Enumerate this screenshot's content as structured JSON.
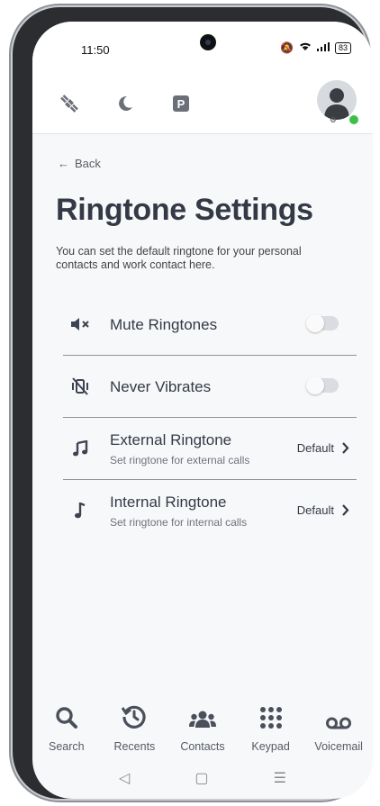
{
  "status_bar": {
    "time": "11:50",
    "battery": "83"
  },
  "appbar": {
    "icons": [
      "satellite-icon",
      "moon-icon",
      "parking-icon"
    ]
  },
  "back_label": "Back",
  "page": {
    "title": "Ringtone Settings",
    "description": "You can set the default ringtone for your personal contacts and work contact here."
  },
  "settings": [
    {
      "label": "Mute Ringtones",
      "icon": "mute-speaker-icon",
      "control": "toggle",
      "on": false
    },
    {
      "label": "Never Vibrates",
      "icon": "vibrate-off-icon",
      "control": "toggle",
      "on": false
    },
    {
      "label": "External Ringtone",
      "subtitle": "Set ringtone for external calls",
      "icon": "music-notes-icon",
      "value": "Default"
    },
    {
      "label": "Internal Ringtone",
      "subtitle": "Set ringtone for internal calls",
      "icon": "music-note-icon",
      "value": "Default"
    }
  ],
  "bottom_nav": [
    {
      "label": "Search",
      "icon": "search-icon"
    },
    {
      "label": "Recents",
      "icon": "history-icon"
    },
    {
      "label": "Contacts",
      "icon": "contacts-icon"
    },
    {
      "label": "Keypad",
      "icon": "keypad-icon"
    },
    {
      "label": "Voicemail",
      "icon": "voicemail-icon"
    }
  ],
  "colors": {
    "toggle_off": "#d9dce1",
    "online_status": "#3bbf4a",
    "title": "#343a45"
  }
}
